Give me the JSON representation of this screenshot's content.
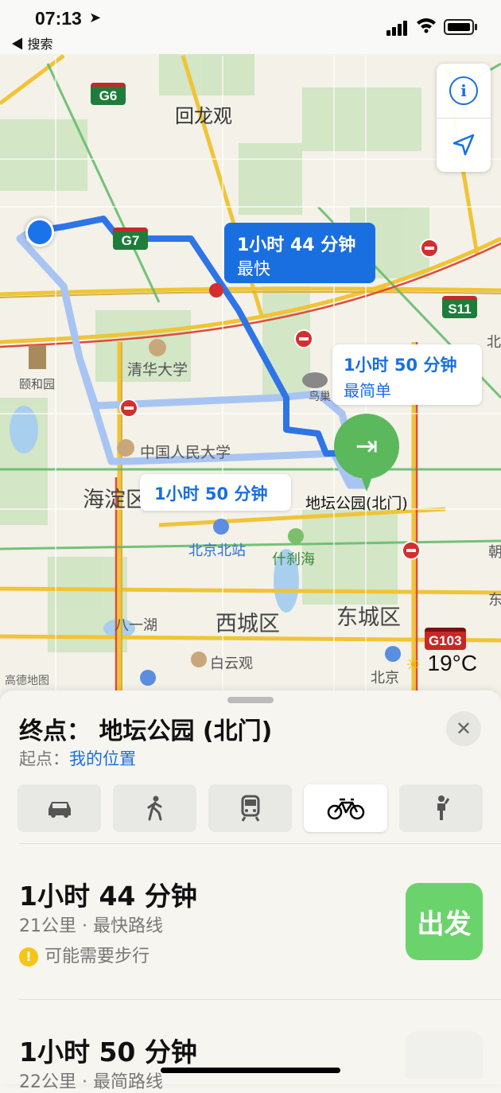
{
  "status": {
    "time": "07:13",
    "back_label": "◀ 搜索"
  },
  "map": {
    "labels": {
      "huilongguan": "回龙观",
      "tsinghua": "清华大学",
      "summer_palace": "颐和园",
      "renmin": "中国人民大学",
      "haidian": "海淀区",
      "ditan": "地坛公园(北门)",
      "beijing_north": "北京北站",
      "shichahai": "什刹海",
      "xicheng": "西城区",
      "dongcheng": "东城区",
      "baiyunguan": "白云观",
      "bayihu": "八一湖",
      "niaochao": "鸟巢",
      "bei": "北",
      "beijing": "北京",
      "chao": "朝",
      "dong": "东"
    },
    "shields": {
      "g6": "G6",
      "g7": "G7",
      "s11": "S11",
      "g103": "G103"
    },
    "routes": {
      "fastest_time": "1小时 44 分钟",
      "fastest_tag": "最快",
      "simplest_time": "1小时 50 分钟",
      "simplest_tag": "最简单",
      "third_time": "1小时 50 分钟"
    },
    "weather": "19°C",
    "attribution": "高德地图",
    "icons": {
      "info": "i",
      "location": "navigation-arrow-icon"
    }
  },
  "sheet": {
    "destination": "终点：  地坛公园 (北门)",
    "origin_label": "起点：",
    "origin_value": "我的位置",
    "modes": [
      "car",
      "walk",
      "transit",
      "bike",
      "ride-share"
    ],
    "active_mode": "bike",
    "route1": {
      "duration": "1小时 44 分钟",
      "detail": "21公里 · 最快路线",
      "warning": "可能需要步行",
      "go": "出发"
    },
    "route2": {
      "duration": "1小时 50 分钟",
      "detail": "22公里 · 最简路线"
    }
  },
  "colors": {
    "accent": "#1a6fe0",
    "go": "#6bd36b",
    "route": "#2f74e6",
    "alt_route": "#a8c4f2",
    "dest": "#5cb85c"
  }
}
